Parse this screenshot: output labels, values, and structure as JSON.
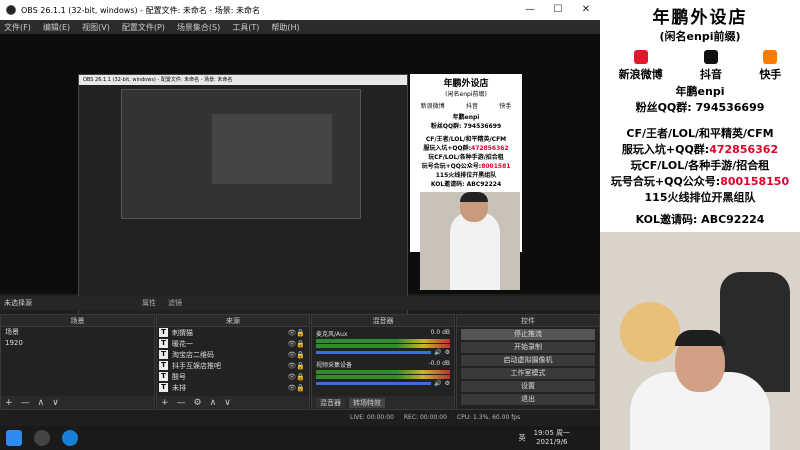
{
  "window": {
    "title": "OBS 26.1.1 (32-bit, windows) - 配置文件: 未命名 - 场景: 未命名",
    "controls": [
      "—",
      "☐",
      "✕"
    ]
  },
  "menu": [
    "文件(F)",
    "编辑(E)",
    "视图(V)",
    "配置文件(P)",
    "场景集合(S)",
    "工具(T)",
    "帮助(H)"
  ],
  "nested_preview_title": "OBS 26.1.1 (32-bit, windows) - 配置文件: 未命名 - 场景: 未命名",
  "ad_small": {
    "title": "年鹏外设店",
    "sub": "(闲名enpi前缀)",
    "social": [
      "新浪微博",
      "抖音",
      "快手"
    ],
    "name": "年鹏enpi",
    "qq": "粉丝QQ群: 794536699",
    "line1": "CF/王者/LOL/和平精英/CFM",
    "line2a": "服玩入坑+QQ群:",
    "line2b": "472856362",
    "line3": "玩CF/LOL/各种手游/招合租",
    "line4a": "玩号合玩+QQ公众号:",
    "line4b": "8001581",
    "line5": "115火线排位开黑组队",
    "line6": "KOL邀请码: ABC92224"
  },
  "no_source": {
    "label": "未选择源",
    "properties": "属性",
    "filters": "滤镜"
  },
  "scenes": {
    "header": "场景",
    "items": [
      "场景",
      "1920"
    ],
    "footer": [
      "+",
      "—",
      "∧",
      "∨"
    ]
  },
  "sources": {
    "header": "来源",
    "items": [
      {
        "icon": "T",
        "label": "刺猬猫"
      },
      {
        "icon": "T",
        "label": "暖花一"
      },
      {
        "icon": "T",
        "label": "淘宝店二维码"
      },
      {
        "icon": "T",
        "label": "抖手互娱店推吧"
      },
      {
        "icon": "T",
        "label": "酸号"
      },
      {
        "icon": "T",
        "label": "未排"
      }
    ],
    "footer": [
      "+",
      "—",
      "⚙",
      "∧",
      "∨"
    ]
  },
  "mixer": {
    "header": "混音器",
    "tracks": [
      {
        "name": "麦克风/Aux",
        "db": "0.0 dB"
      },
      {
        "name": "视频采集设备",
        "db": "-0.0 dB"
      }
    ],
    "tabs": [
      "混音器",
      "转场特效"
    ]
  },
  "controls": {
    "header": "控件",
    "buttons": [
      "停止推流",
      "开始录制",
      "启动虚拟摄像机",
      "工作室模式",
      "设置",
      "退出"
    ]
  },
  "status": {
    "live": "LIVE: 00:00:00",
    "rec": "REC: 00:00:00",
    "cpu": "CPU: 1.3%, 60.00 fps"
  },
  "taskbar": {
    "time": "19:05 周一",
    "date": "2021/9/6",
    "lang": "英"
  },
  "right_panel": {
    "title": "年鹏外设店",
    "sub": "(闲名enpi前缀)",
    "social": [
      {
        "label": "新浪微博",
        "icon": "weibo-icon",
        "color": "#e6162d"
      },
      {
        "label": "抖音",
        "icon": "douyin-icon",
        "color": "#111111"
      },
      {
        "label": "快手",
        "icon": "kuaishou-icon",
        "color": "#ff7a00"
      }
    ],
    "name": "年鹏enpi",
    "qq": "粉丝QQ群: 794536699",
    "line1": "CF/王者/LOL/和平精英/CFM",
    "line2a": "服玩入坑+QQ群:",
    "line2b": "472856362",
    "line3": "玩CF/LOL/各种手游/招合租",
    "line4a": "玩号合玩+QQ公众号:",
    "line4b": "800158150",
    "line5": "115火线排位开黑组队",
    "line6": "KOL邀请码: ABC92224"
  },
  "colors": {
    "accent_red": "#e0002a",
    "obs_dark": "#222222",
    "panel_white": "#ffffff"
  }
}
